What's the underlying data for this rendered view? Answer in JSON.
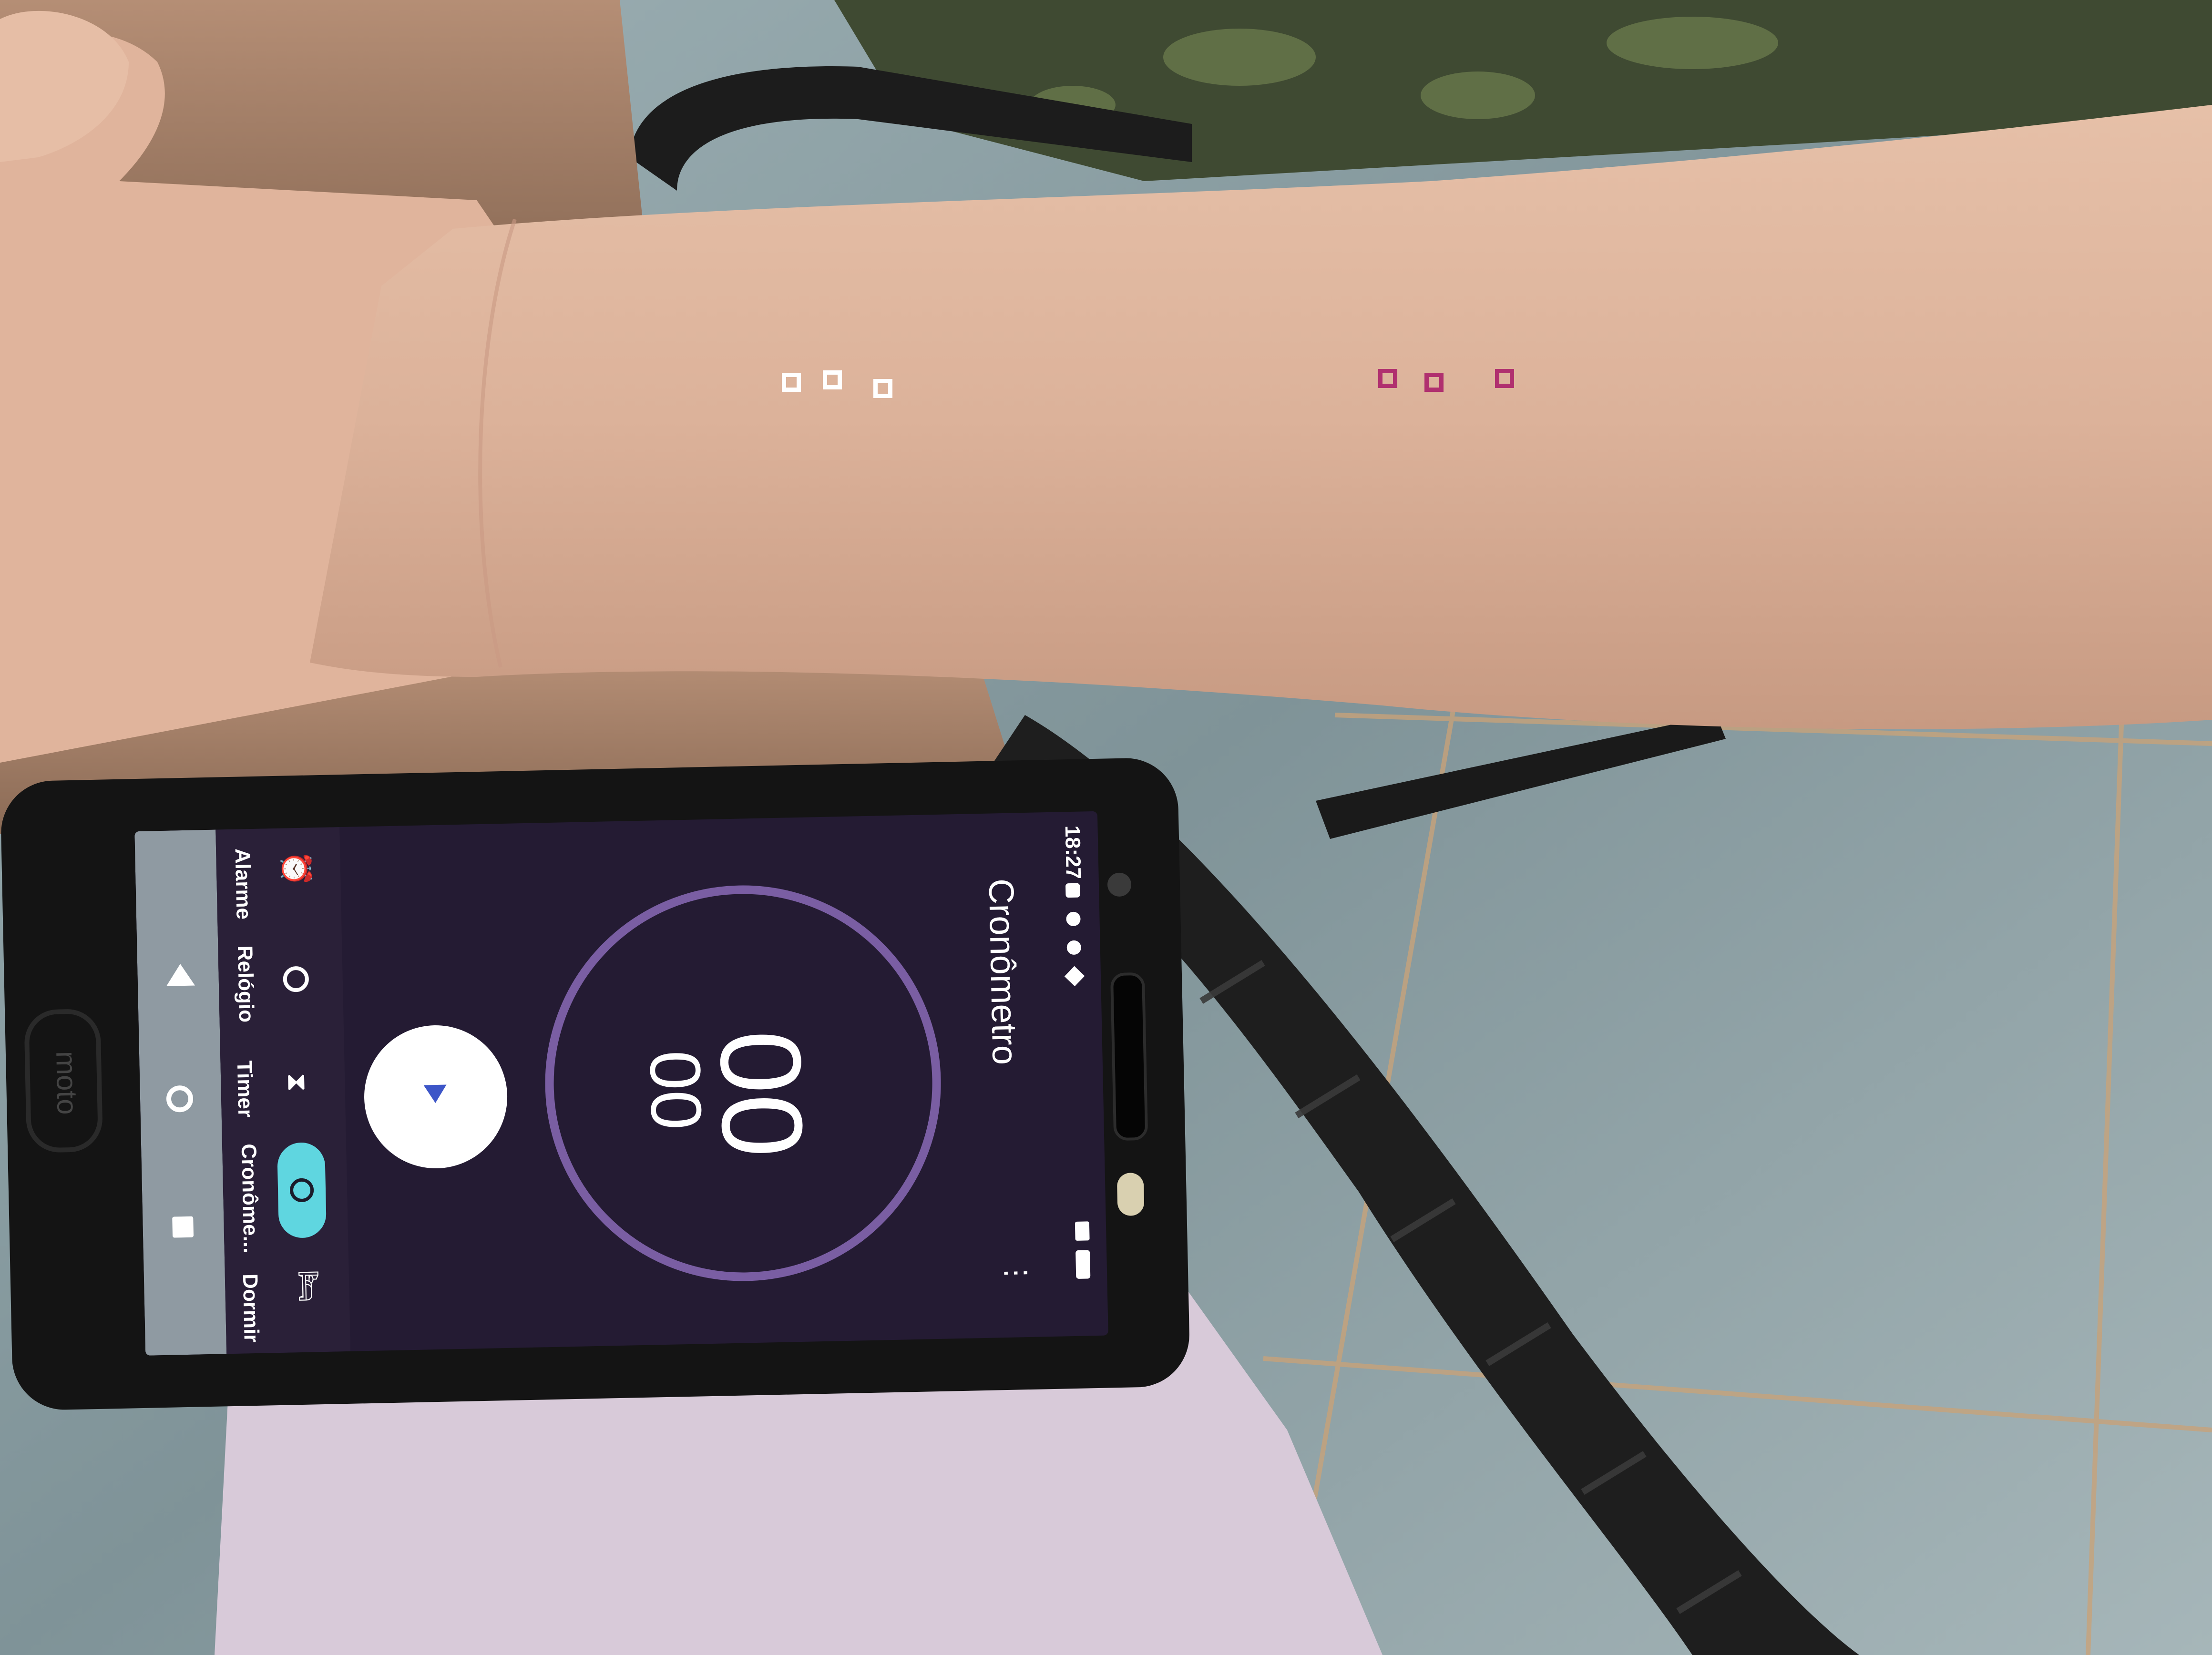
{
  "colors": {
    "marker_white": "#ffffff",
    "marker_magenta": "#b0306f",
    "ring": "#7a5ea3",
    "screen_bg": "#241b33",
    "accent_teal": "#5fd6e0"
  },
  "markers": {
    "white_count": 3,
    "magenta_count": 3
  },
  "phone": {
    "status": {
      "time": "18:27"
    },
    "header": {
      "title": "Cronômetro",
      "menu_icon": "more-vert-icon"
    },
    "stopwatch": {
      "main": "00",
      "fraction": "00"
    },
    "play_icon": "play-icon",
    "tabs": [
      {
        "label": "Alarme",
        "icon": "alarm-icon"
      },
      {
        "label": "Relógio",
        "icon": "clock-icon"
      },
      {
        "label": "Timer",
        "icon": "hourglass-icon"
      },
      {
        "label": "Cronôme...",
        "icon": "stopwatch-icon",
        "active": true
      },
      {
        "label": "Dormir",
        "icon": "bed-icon"
      }
    ],
    "nav_icons": [
      "back-icon",
      "home-icon",
      "recents-icon"
    ],
    "brand": "moto"
  }
}
